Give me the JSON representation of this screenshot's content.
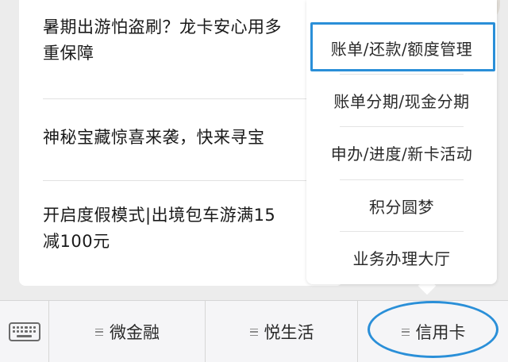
{
  "feed": {
    "articles": [
      {
        "lines": [
          "暑期出游怕盗刷？龙卡安心用多",
          "重保障"
        ]
      },
      {
        "lines": [
          "神秘宝藏惊喜来袭，快来寻宝"
        ]
      },
      {
        "lines": [
          "开启度假模式|出境包车游满15",
          "减100元"
        ]
      }
    ]
  },
  "popup_menu": {
    "items": [
      {
        "label": "账单/还款/额度管理",
        "highlighted": true
      },
      {
        "label": "账单分期/现金分期"
      },
      {
        "label": "申办/进度/新卡活动"
      },
      {
        "label": "积分圆梦"
      },
      {
        "label": "业务办理大厅"
      }
    ],
    "highlight_color": "#2a8fd8"
  },
  "bottom_bar": {
    "keyboard_icon": "keyboard-icon",
    "tabs": [
      {
        "label": "微金融",
        "icon": "menu-icon"
      },
      {
        "label": "悦生活",
        "icon": "menu-icon"
      },
      {
        "label": "信用卡",
        "icon": "menu-icon",
        "circled": true
      }
    ]
  }
}
